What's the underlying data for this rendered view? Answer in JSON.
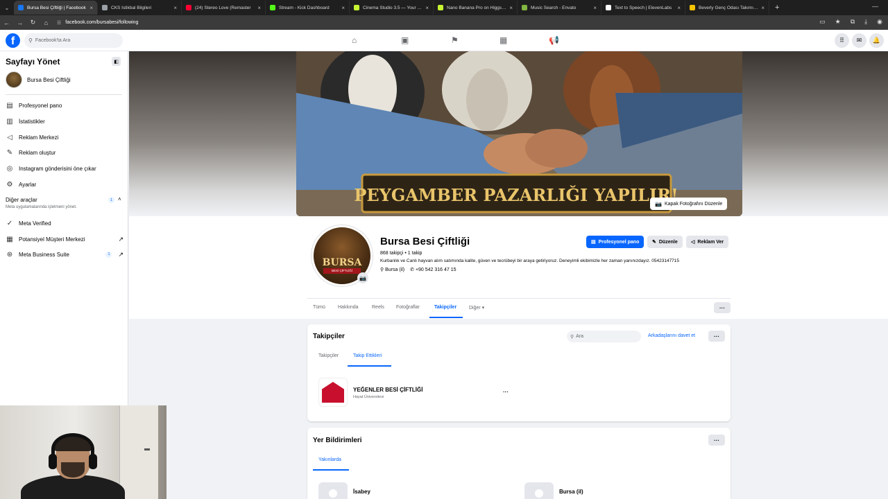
{
  "browser": {
    "tabs": [
      {
        "label": "Bursa Besi Çiftliği | Facebook",
        "color": "#1877f2",
        "active": true
      },
      {
        "label": "CKS İstikbal Bilgileri",
        "color": "#9aa0a6",
        "active": false
      },
      {
        "label": "(24) Stereo Love (Remaster",
        "color": "#ff0033",
        "active": false
      },
      {
        "label": "Stream - Kick Dashboard",
        "color": "#53fc18",
        "active": false
      },
      {
        "label": "Cinema Studio 3.5 — Your AI D",
        "color": "#c6f432",
        "active": false
      },
      {
        "label": "Nano Banana Pro on Higgsfield",
        "color": "#c6f432",
        "active": false
      },
      {
        "label": "Music Search - Envato",
        "color": "#82b541",
        "active": false
      },
      {
        "label": "Text to Speech | ElevenLabs",
        "color": "#ffffff",
        "active": false
      },
      {
        "label": "Beverly Genç Odası Takımı 5880",
        "color": "#f5c400",
        "active": false
      }
    ],
    "url": "facebook.com/bursabesi/following"
  },
  "header": {
    "search_placeholder": "Facebook'ta Ara"
  },
  "sidebar": {
    "title": "Sayfayı Yönet",
    "page_name": "Bursa Besi Çiftliği",
    "items": [
      {
        "label": "Profesyonel pano",
        "icon": "dashboard-icon"
      },
      {
        "label": "İstatistikler",
        "icon": "insights-icon"
      },
      {
        "label": "Reklam Merkezi",
        "icon": "megaphone-icon"
      },
      {
        "label": "Reklam oluştur",
        "icon": "edit-icon"
      },
      {
        "label": "Instagram gönderisini öne çıkar",
        "icon": "instagram-icon"
      },
      {
        "label": "Ayarlar",
        "icon": "gear-icon"
      }
    ],
    "other_tools": {
      "title": "Diğer araçlar",
      "subtitle": "Meta uygulamalarında işletmeni yönet.",
      "badge": "1"
    },
    "tools": [
      {
        "label": "Meta Verified",
        "icon": "verified-icon"
      },
      {
        "label": "Potansiyel Müşteri Merkezi",
        "icon": "leads-icon"
      },
      {
        "label": "Meta Business Suite",
        "icon": "business-suite-icon",
        "badge": "1"
      }
    ]
  },
  "cover": {
    "banner_text": "PEYGAMBER PAZARLIĞI YAPILIR!",
    "edit_label": "Kapak Fotoğrafını Düzenle"
  },
  "profile": {
    "avatar_title": "BURSA",
    "avatar_subtitle": "BESİ ÇİFTLİĞİ",
    "name": "Bursa Besi Çiftliği",
    "stats": "868 takipçi • 1 takip",
    "bio": "Kurbanlık ve Canlı hayvan alım satımında kalite, güven ve tecrübeyi bir araya getiriyoruz. Deneyimli ekibimizle her zaman yanınızdayız. 05423147715",
    "location": "Bursa (il)",
    "phone": "+90 542 316 47 15",
    "buttons": {
      "pro": "Profesyonel pano",
      "edit": "Düzenle",
      "ads": "Reklam Ver"
    }
  },
  "tabs": [
    {
      "label": "Tümü"
    },
    {
      "label": "Hakkında"
    },
    {
      "label": "Reels"
    },
    {
      "label": "Fotoğraflar"
    },
    {
      "label": "Takipçiler"
    },
    {
      "label": "Diğer ▾"
    }
  ],
  "followers_card": {
    "title": "Takipçiler",
    "search_placeholder": "Ara",
    "invite": "Arkadaşlarını davet et",
    "subtabs": [
      "Takipçiler",
      "Takip Ettikleri"
    ],
    "item": {
      "name": "YEĞENLER BESİ ÇİFTLİĞİ",
      "subtitle": "Hayat Üniversitesi"
    }
  },
  "places_card": {
    "title": "Yer Bildirimleri",
    "subtab": "Yakınlarda",
    "places": [
      "İsabey",
      "Bursa (il)"
    ]
  },
  "colors": {
    "accent": "#0866ff",
    "bg": "#f0f2f5"
  }
}
